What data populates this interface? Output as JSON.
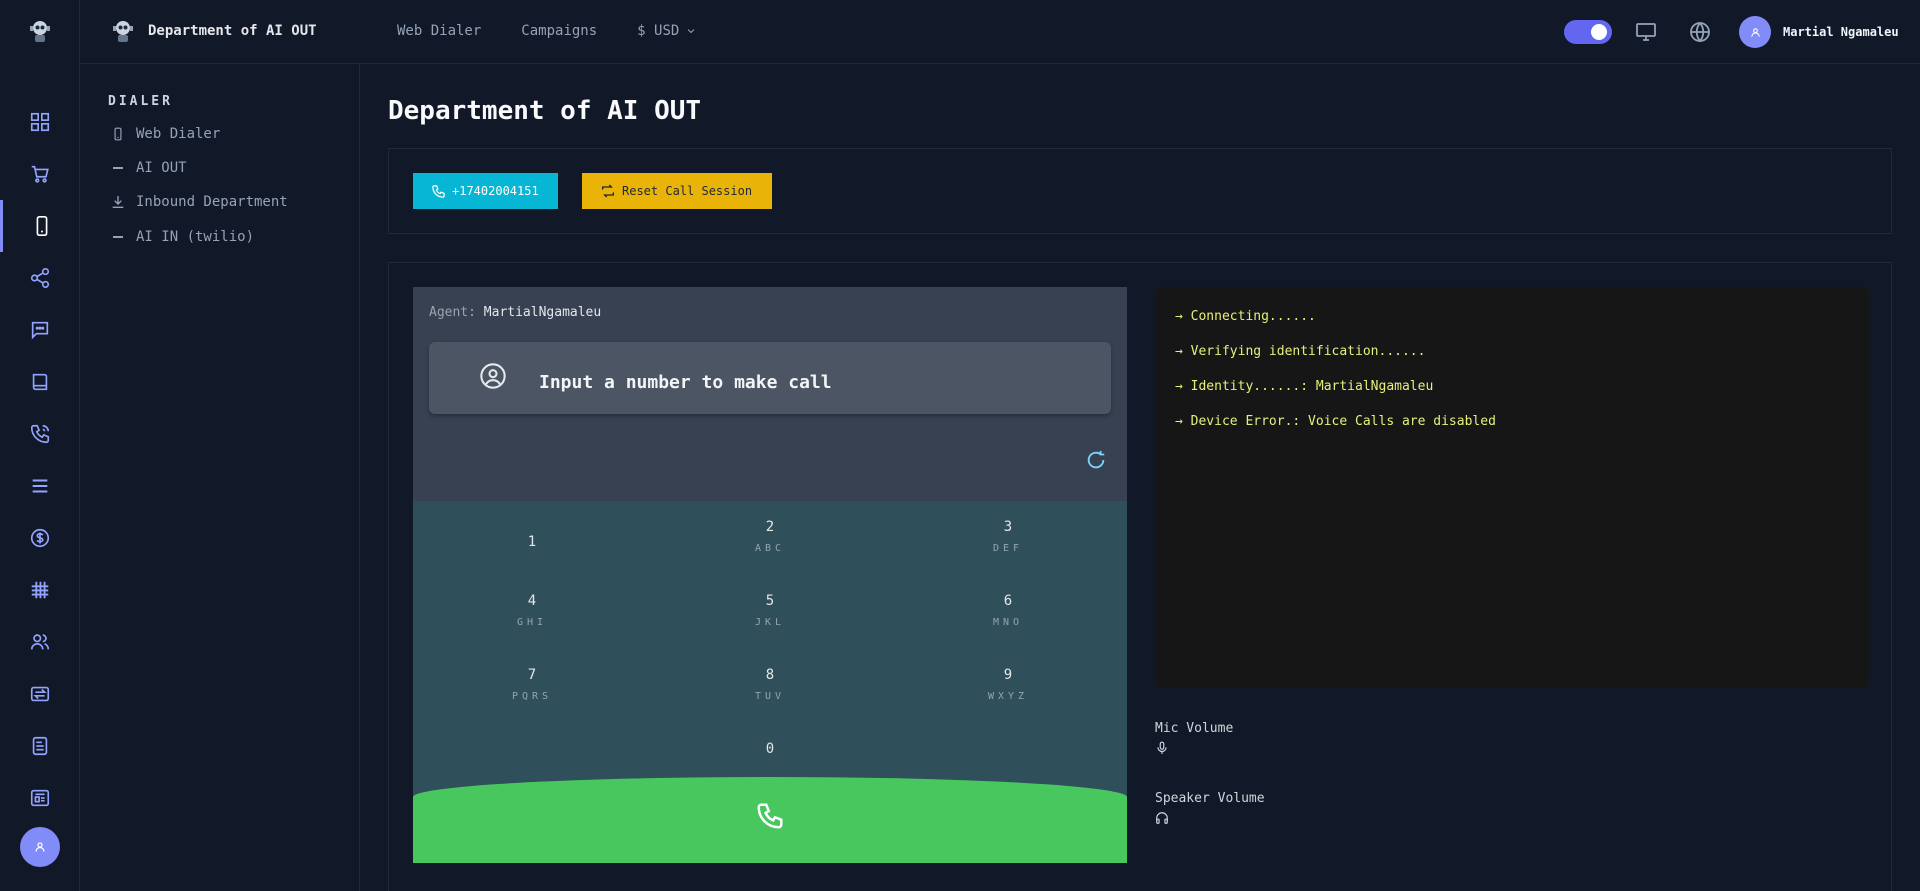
{
  "colors": {
    "accent": "#818cf8",
    "call_button": "#06b6d4",
    "reset_button": "#eab308",
    "call_green": "#48c75f",
    "console_text": "#e6f07a"
  },
  "header": {
    "brand_name": "Department of AI OUT",
    "nav": [
      "Web Dialer",
      "Campaigns",
      "$ USD"
    ],
    "user_name": "Martial Ngamaleu"
  },
  "rail_icons": [
    "dashboard-icon",
    "cart-icon",
    "phone-device-icon",
    "share-icon",
    "chat-icon",
    "book-icon",
    "phone-call-icon",
    "list-icon",
    "dollar-icon",
    "grid-icon",
    "users-icon",
    "transfer-icon",
    "report-icon",
    "newspaper-icon"
  ],
  "sidebar": {
    "section": "DIALER",
    "items": [
      {
        "label": "Web Dialer",
        "icon": "phone-device-icon"
      },
      {
        "label": "AI OUT",
        "icon": "dash-icon"
      },
      {
        "label": "Inbound Department",
        "icon": "download-icon"
      },
      {
        "label": "AI IN (twilio)",
        "icon": "dash-icon"
      }
    ]
  },
  "main": {
    "title": "Department of AI OUT",
    "call_button": "+17402004151",
    "reset_button": "Reset Call Session"
  },
  "dialer": {
    "agent_label": "Agent:",
    "agent_name": "MartialNgamaleu",
    "placeholder": "Input a number to make call",
    "keys": [
      {
        "digit": "1",
        "letters": ""
      },
      {
        "digit": "2",
        "letters": "ABC"
      },
      {
        "digit": "3",
        "letters": "DEF"
      },
      {
        "digit": "4",
        "letters": "GHI"
      },
      {
        "digit": "5",
        "letters": "JKL"
      },
      {
        "digit": "6",
        "letters": "MNO"
      },
      {
        "digit": "7",
        "letters": "PQRS"
      },
      {
        "digit": "8",
        "letters": "TUV"
      },
      {
        "digit": "9",
        "letters": "WXYZ"
      },
      {
        "digit": "0",
        "letters": ""
      }
    ]
  },
  "console": {
    "lines": [
      "→ Connecting......",
      "→ Verifying identification......",
      "→ Identity......: MartialNgamaleu",
      "→ Device Error.: Voice Calls are disabled"
    ]
  },
  "volume": {
    "mic_label": "Mic Volume",
    "speaker_label": "Speaker Volume"
  }
}
